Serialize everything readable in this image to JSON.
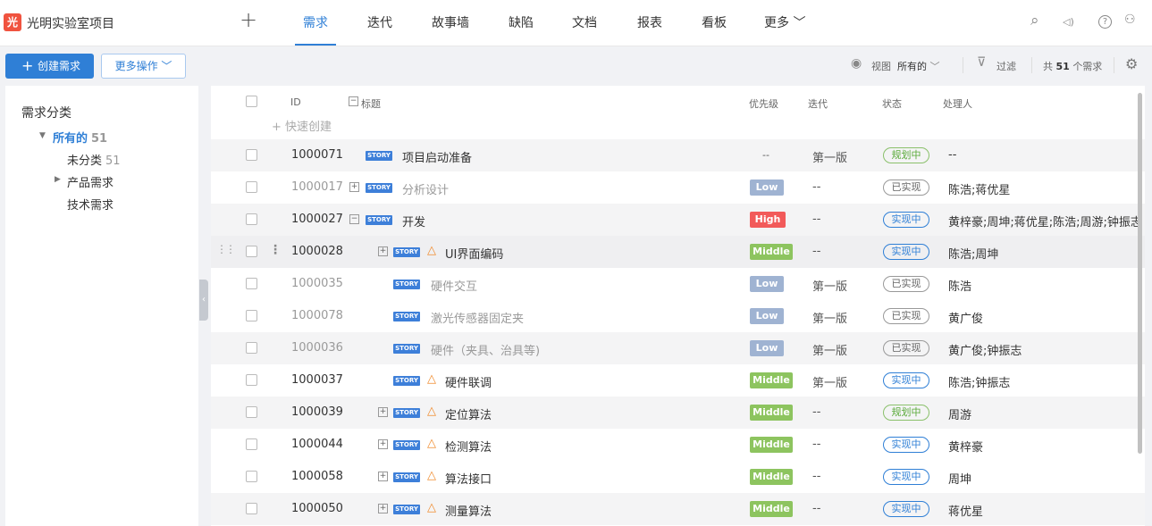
{
  "project": {
    "logo_char": "光",
    "name": "光明实验室项目"
  },
  "nav": {
    "add_label": "+",
    "items": [
      {
        "label": "需求",
        "active": true
      },
      {
        "label": "迭代"
      },
      {
        "label": "故事墙"
      },
      {
        "label": "缺陷"
      },
      {
        "label": "文档"
      },
      {
        "label": "报表"
      },
      {
        "label": "看板"
      },
      {
        "label": "更多 ﹀"
      }
    ]
  },
  "toolbar": {
    "create_label": "创建需求",
    "more_actions_label": "更多操作 ﹀",
    "view_label": "视图",
    "view_value": "所有的",
    "filter_label": "过滤",
    "total_prefix": "共",
    "total_count": "51",
    "total_suffix": "个需求"
  },
  "sidebar": {
    "title": "需求分类",
    "items": [
      {
        "label": "所有的",
        "count": "51"
      },
      {
        "label": "未分类",
        "count": "51"
      },
      {
        "label": "产品需求",
        "count": ""
      },
      {
        "label": "技术需求",
        "count": ""
      }
    ]
  },
  "table": {
    "headers": {
      "id": "ID",
      "title": "标题",
      "priority": "优先级",
      "iteration": "迭代",
      "status": "状态",
      "owner": "处理人"
    },
    "quick_create": "快速创建",
    "rows": [
      {
        "id": "1000071",
        "title": "项目启动准备",
        "tag": "STORY",
        "priority": "--",
        "iteration": "第一版",
        "status": "规划中",
        "owner": "--"
      },
      {
        "id": "1000017",
        "title": "分析设计",
        "tag": "STORY",
        "priority": "Low",
        "iteration": "--",
        "status": "已实现",
        "owner": "陈浩;蒋优星"
      },
      {
        "id": "1000027",
        "title": "开发",
        "tag": "STORY",
        "priority": "High",
        "iteration": "--",
        "status": "实现中",
        "owner": "黄梓豪;周坤;蒋优星;陈浩;周游;钟振志"
      },
      {
        "id": "1000028",
        "title": "UI界面编码",
        "tag": "STORY",
        "priority": "Middle",
        "iteration": "--",
        "status": "实现中",
        "owner": "陈浩;周坤"
      },
      {
        "id": "1000035",
        "title": "硬件交互",
        "tag": "STORY",
        "priority": "Low",
        "iteration": "第一版",
        "status": "已实现",
        "owner": "陈浩"
      },
      {
        "id": "1000078",
        "title": "激光传感器固定夹",
        "tag": "STORY",
        "priority": "Low",
        "iteration": "第一版",
        "status": "已实现",
        "owner": "黄广俊"
      },
      {
        "id": "1000036",
        "title": "硬件（夹具、治具等)",
        "tag": "STORY",
        "priority": "Low",
        "iteration": "第一版",
        "status": "已实现",
        "owner": "黄广俊;钟振志"
      },
      {
        "id": "1000037",
        "title": "硬件联调",
        "tag": "STORY",
        "priority": "Middle",
        "iteration": "第一版",
        "status": "实现中",
        "owner": "陈浩;钟振志"
      },
      {
        "id": "1000039",
        "title": "定位算法",
        "tag": "STORY",
        "priority": "Middle",
        "iteration": "--",
        "status": "规划中",
        "owner": "周游"
      },
      {
        "id": "1000044",
        "title": "检测算法",
        "tag": "STORY",
        "priority": "Middle",
        "iteration": "--",
        "status": "实现中",
        "owner": "黄梓豪"
      },
      {
        "id": "1000058",
        "title": "算法接口",
        "tag": "STORY",
        "priority": "Middle",
        "iteration": "--",
        "status": "实现中",
        "owner": "周坤"
      },
      {
        "id": "1000050",
        "title": "测量算法",
        "tag": "STORY",
        "priority": "Middle",
        "iteration": "--",
        "status": "实现中",
        "owner": "蒋优星"
      }
    ]
  },
  "icons": {
    "search": "⌕",
    "speaker": "◁)",
    "help": "?",
    "user": "⚇",
    "eye": "◉",
    "filter": "⊽",
    "settings": "⚙",
    "warn": "△"
  },
  "colors": {
    "accent": "#2f7fd6",
    "high": "#f25a5a",
    "middle": "#8dc45f",
    "low": "#9fb3d2",
    "logo": "#f0533f"
  }
}
